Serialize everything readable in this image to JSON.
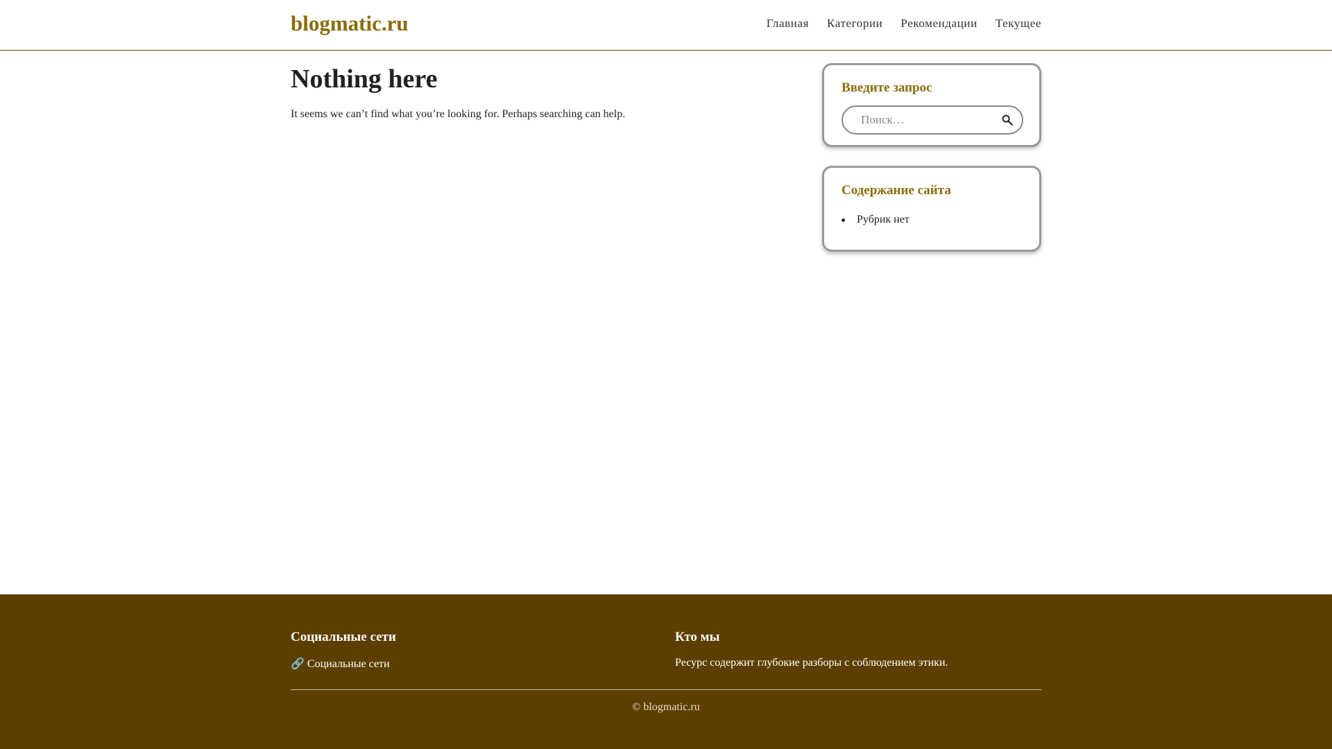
{
  "header": {
    "site_title": "blogmatic.ru",
    "nav": [
      {
        "label": "Главная"
      },
      {
        "label": "Категории"
      },
      {
        "label": "Рекомендации"
      },
      {
        "label": "Текущее"
      }
    ]
  },
  "main": {
    "title": "Nothing here",
    "message": "It seems we can’t find what you’re looking for. Perhaps searching can help."
  },
  "sidebar": {
    "search_widget": {
      "title": "Введите запрос",
      "placeholder": "Поиск…",
      "icon": "search-icon"
    },
    "categories_widget": {
      "title": "Содержание сайта",
      "items": [
        {
          "label": "Рубрик нет"
        }
      ]
    }
  },
  "footer": {
    "social": {
      "heading": "Социальные сети",
      "link_icon": "🔗",
      "link_label": "Социальные сети"
    },
    "about": {
      "heading": "Кто мы",
      "text": "Ресурс содержит глубокие разборы с соблюдением этики."
    },
    "copyright": "© blogmatic.ru"
  },
  "colors": {
    "brand": "#8a6d0b",
    "footer_bg": "#5c3f00",
    "border": "#999999"
  }
}
